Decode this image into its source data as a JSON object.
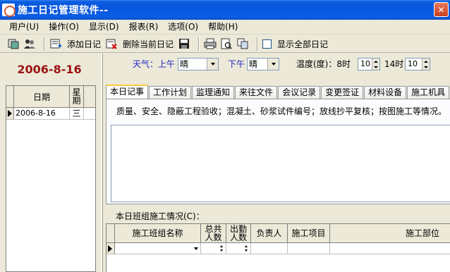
{
  "window": {
    "title": "施工日记管理软件--"
  },
  "menu": [
    {
      "label": "用户(U)"
    },
    {
      "label": "操作(O)"
    },
    {
      "label": "显示(D)"
    },
    {
      "label": "报表(R)"
    },
    {
      "label": "选项(O)"
    },
    {
      "label": "帮助(H)"
    }
  ],
  "toolbar": {
    "add_label": "添加日记",
    "delete_label": "删除当前日记",
    "show_all_label": "显示全部日记"
  },
  "left": {
    "current_date": "2006-8-16",
    "grid": {
      "col_date": "日期",
      "col_weekday": "星期",
      "rows": [
        {
          "date": "2006-8-16",
          "weekday": "三"
        }
      ]
    }
  },
  "weather": {
    "am_label": "天气：上午",
    "am_value": "晴",
    "pm_label": "下午",
    "pm_value": "晴",
    "temp_label": "温度(度)：8时",
    "temp8_value": "10",
    "temp14_label": "14时",
    "temp14_value": "10"
  },
  "tabs": [
    {
      "label": "本日记事"
    },
    {
      "label": "工作计划"
    },
    {
      "label": "监理通知"
    },
    {
      "label": "来往文件"
    },
    {
      "label": "会议记录"
    },
    {
      "label": "变更签证"
    },
    {
      "label": "材料设备"
    },
    {
      "label": "施工机具"
    }
  ],
  "tab_description": "质量、安全、隐蔽工程验收；混凝土、砂浆试件编号；放线抄平复核；按图施工等情况。",
  "team": {
    "label": "本日班组施工情况(C)：",
    "columns": [
      "施工班组名称",
      "总共人数",
      "出勤人数",
      "负责人",
      "施工项目",
      "施工部位"
    ]
  },
  "colors": {
    "title_bar": "#0855dd",
    "date_red": "#9c1414",
    "label_blue": "#1e24c6",
    "tab_highlight": "#ffc83c"
  }
}
